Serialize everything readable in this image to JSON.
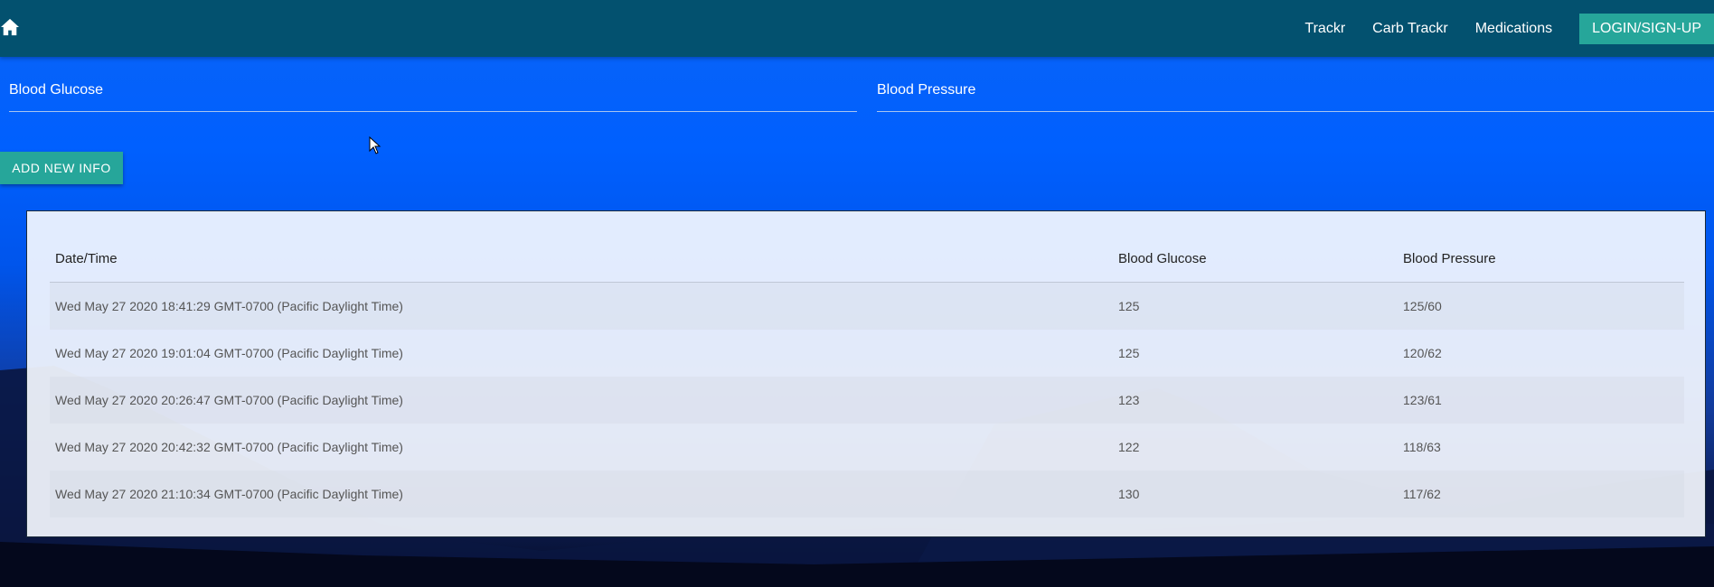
{
  "navbar": {
    "home_icon": "home-icon",
    "links": [
      "Trackr",
      "Carb Trackr",
      "Medications"
    ],
    "login_label": "LOGIN/SIGN-UP",
    "background_color": "#03516f",
    "accent_color": "#26a69a"
  },
  "form": {
    "blood_glucose_placeholder": "Blood Glucose",
    "blood_glucose_value": "",
    "blood_pressure_placeholder": "Blood Pressure",
    "blood_pressure_value": "",
    "add_button_label": "ADD NEW INFO"
  },
  "table": {
    "headers": [
      "Date/Time",
      "Blood Glucose",
      "Blood Pressure"
    ],
    "rows": [
      [
        "Wed May 27 2020 18:41:29 GMT-0700 (Pacific Daylight Time)",
        "125",
        "125/60"
      ],
      [
        "Wed May 27 2020 19:01:04 GMT-0700 (Pacific Daylight Time)",
        "125",
        "120/62"
      ],
      [
        "Wed May 27 2020 20:26:47 GMT-0700 (Pacific Daylight Time)",
        "123",
        "123/61"
      ],
      [
        "Wed May 27 2020 20:42:32 GMT-0700 (Pacific Daylight Time)",
        "122",
        "118/63"
      ],
      [
        "Wed May 27 2020 21:10:34 GMT-0700 (Pacific Daylight Time)",
        "130",
        "117/62"
      ]
    ]
  }
}
